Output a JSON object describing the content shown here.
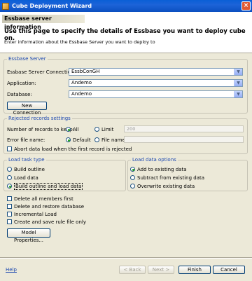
{
  "window": {
    "title": "Cube Deployment Wizard"
  },
  "header": {
    "banner": "Essbase server information",
    "description": "Use this page to specify the details of Essbase you want to deploy cube on.",
    "subtext": "Enter information about the Essbase Server you want to deploy to"
  },
  "essbase": {
    "legend": "Essbase Server",
    "connection_label": "Essbase Server Connection:",
    "connection_value": "EssbConGH",
    "application_label": "Application:",
    "application_value": "Andemo",
    "database_label": "Database:",
    "database_value": "Andemo",
    "new_connection": "New Connection"
  },
  "rejected": {
    "legend": "Rejected records settings",
    "records_label": "Number of records to keep:",
    "all_label": "All",
    "limit_label": "Limit",
    "limit_value": "200",
    "error_label": "Error file name:",
    "default_label": "Default",
    "filename_label": "File name",
    "abort_label": "Abort data load when the first record is rejected"
  },
  "loadtask": {
    "legend": "Load task type",
    "build_outline": "Build outline",
    "load_data": "Load data",
    "build_and_load": "Build outline and load data"
  },
  "loaddata": {
    "legend": "Load data options",
    "add_existing": "Add to existing data",
    "subtract_existing": "Subtract from existing data",
    "overwrite_existing": "Overwrite existing data"
  },
  "options": {
    "delete_all": "Delete all members first",
    "delete_restore": "Delete and restore database",
    "incremental": "Incremental Load",
    "create_rule": "Create and save rule file only",
    "model_properties": "Model Properties..."
  },
  "footer": {
    "help": "Help",
    "back": "< Back",
    "next": "Next >",
    "finish": "Finish",
    "cancel": "Cancel"
  }
}
